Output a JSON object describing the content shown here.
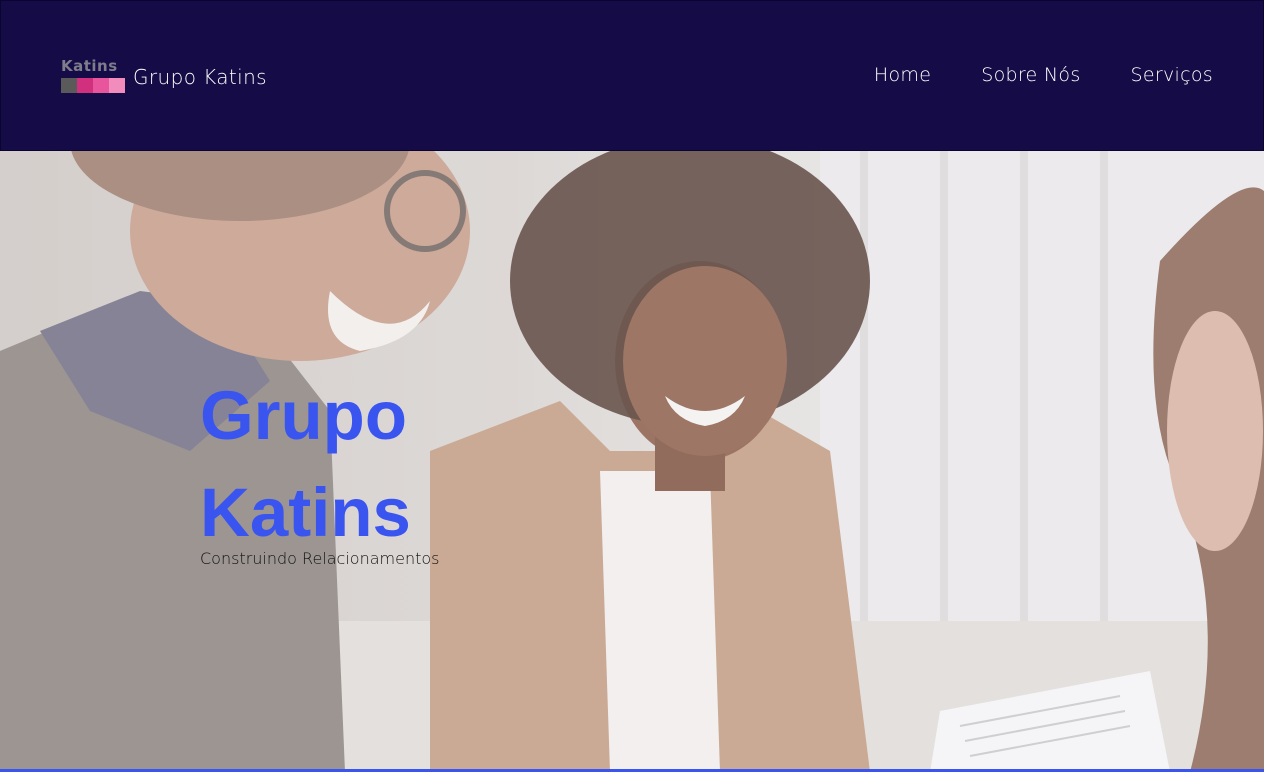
{
  "navbar": {
    "logo_text": "Katins",
    "logo_colors": [
      "#5a5a5a",
      "#d0307e",
      "#e8559c",
      "#f28cbd"
    ],
    "brand_name": "Grupo Katins",
    "links": [
      {
        "label": "Home"
      },
      {
        "label": "Sobre Nós"
      },
      {
        "label": "Serviços"
      }
    ],
    "background": "#150b46"
  },
  "hero": {
    "title": "Grupo Katins",
    "subtitle": "Construindo Relacionamentos",
    "title_color": "#3a55ef",
    "image_description_icon": "office-meeting-photo"
  }
}
